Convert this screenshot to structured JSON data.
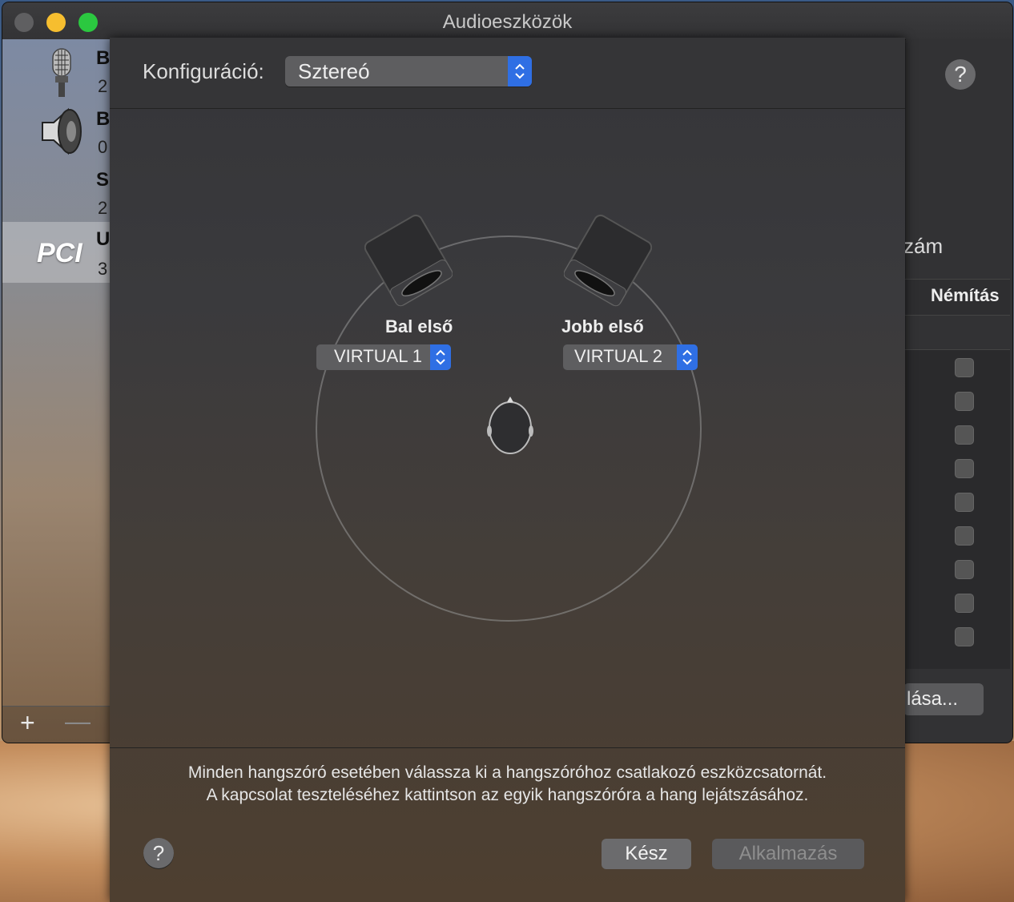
{
  "window": {
    "title": "Audioeszközök"
  },
  "sidebar": {
    "devices": [
      {
        "name": "B",
        "count": "2",
        "icon": "microphone-icon"
      },
      {
        "name": "B",
        "count": "0",
        "icon": "speaker-icon"
      },
      {
        "name": "S",
        "count": "2",
        "icon": ""
      },
      {
        "name": "U",
        "count": "3",
        "icon": "pci-icon",
        "icon_text": "PCI",
        "selected": true
      }
    ],
    "add_label": "+",
    "remove_label": "—"
  },
  "background_panel": {
    "help_label": "?",
    "partial_label": "zám",
    "mute_header": "Némítás",
    "button_label": "lása..."
  },
  "sheet": {
    "config_label": "Konfiguráció:",
    "config_value": "Sztereó",
    "speakers": {
      "left": {
        "label": "Bal első",
        "channel": "VIRTUAL 1"
      },
      "right": {
        "label": "Jobb első",
        "channel": "VIRTUAL 2"
      }
    },
    "instructions": {
      "line1": "Minden hangszóró esetében válassza ki a hangszóróhoz csatlakozó eszközcsatornát.",
      "line2": "A kapcsolat teszteléséhez kattintson az egyik hangszóróra a hang lejátszásához."
    },
    "help_label": "?",
    "done_label": "Kész",
    "apply_label": "Alkalmazás"
  },
  "colors": {
    "accent": "#2f6fe4",
    "window_bg": "#2b2b2d"
  }
}
